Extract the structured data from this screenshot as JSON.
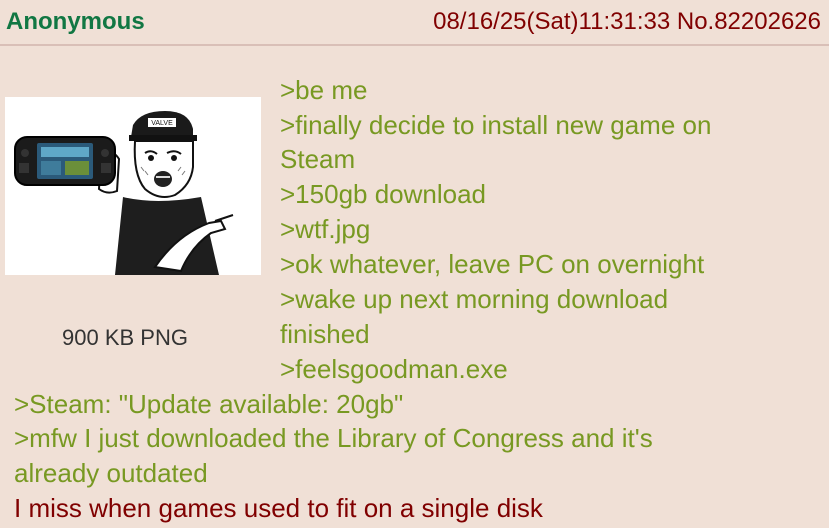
{
  "header": {
    "name": "Anonymous",
    "datetime": "08/16/25(Sat)11:31:33",
    "post_no": "No.82202626"
  },
  "file": {
    "info": "900 KB PNG",
    "badge_text": "VALVE"
  },
  "body": {
    "lines": [
      ">be me",
      ">finally decide to install new game on",
      "Steam",
      ">150gb download",
      ">wtf.jpg",
      ">ok whatever, leave PC on overnight",
      ">wake up next morning download",
      "finished",
      ">feelsgoodman.exe",
      ">Steam: \"Update available: 20gb\"",
      ">mfw I just downloaded the Library of Congress and it's",
      "already outdated",
      "I miss when games used to fit on a single disk"
    ]
  },
  "colors": {
    "background": "#f0e0d6",
    "name": "#117743",
    "meta": "#800000",
    "greentext": "#789922",
    "text": "#800000"
  }
}
